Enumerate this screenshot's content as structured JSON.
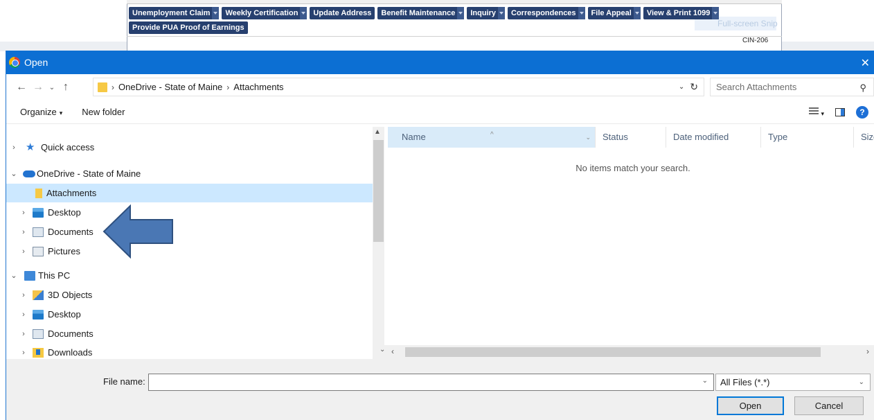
{
  "background_page": {
    "nav_items": [
      {
        "label": "Unemployment Claim",
        "has_menu": true
      },
      {
        "label": "Weekly Certification",
        "has_menu": true
      },
      {
        "label": "Update Address",
        "has_menu": false
      },
      {
        "label": "Benefit Maintenance",
        "has_menu": true
      },
      {
        "label": "Inquiry",
        "has_menu": true
      },
      {
        "label": "Correspondences",
        "has_menu": true
      },
      {
        "label": "File Appeal",
        "has_menu": true
      },
      {
        "label": "View & Print 1099",
        "has_menu": true
      },
      {
        "label": "Provide PUA Proof of Earnings",
        "has_menu": false
      }
    ],
    "page_code": "CIN-206",
    "ghost_text": "Full-screen Snip"
  },
  "dialog": {
    "title": "Open",
    "close_glyph": "✕",
    "address": {
      "crumbs": [
        "OneDrive - State of Maine",
        "Attachments"
      ]
    },
    "search_placeholder": "Search Attachments",
    "toolbar": {
      "organize": "Organize",
      "new_folder": "New folder"
    },
    "tree": [
      {
        "label": "Quick access",
        "icon": "star-icon",
        "expand": "›",
        "selected": false
      },
      {
        "label": "OneDrive - State of Maine",
        "icon": "cloud-icon",
        "expand": "⌄",
        "selected": false
      },
      {
        "label": "Attachments",
        "icon": "folder-icon",
        "expand": "",
        "selected": true
      },
      {
        "label": "Desktop",
        "icon": "desktop-folder-icon",
        "expand": "›",
        "selected": false
      },
      {
        "label": "Documents",
        "icon": "documents-folder-icon",
        "expand": "›",
        "selected": false
      },
      {
        "label": "Pictures",
        "icon": "pictures-folder-icon",
        "expand": "›",
        "selected": false
      },
      {
        "label": "This PC",
        "icon": "computer-icon",
        "expand": "⌄",
        "selected": false
      },
      {
        "label": "3D Objects",
        "icon": "3d-objects-icon",
        "expand": "›",
        "selected": false
      },
      {
        "label": "Desktop",
        "icon": "desktop-folder-icon",
        "expand": "›",
        "selected": false
      },
      {
        "label": "Documents",
        "icon": "documents-folder-icon",
        "expand": "›",
        "selected": false
      },
      {
        "label": "Downloads",
        "icon": "downloads-folder-icon",
        "expand": "›",
        "selected": false
      }
    ],
    "columns": [
      "Name",
      "Status",
      "Date modified",
      "Type",
      "Size"
    ],
    "empty_message": "No items match your search.",
    "file_name_label": "File name:",
    "file_name_value": "",
    "file_type": "All Files (*.*)",
    "open_button": "Open",
    "cancel_button": "Cancel"
  },
  "colors": {
    "title_bar": "#0c6fd3",
    "nav_button": "#27406f",
    "selection": "#cce8ff",
    "annotation_arrow": "#4a77b4"
  }
}
